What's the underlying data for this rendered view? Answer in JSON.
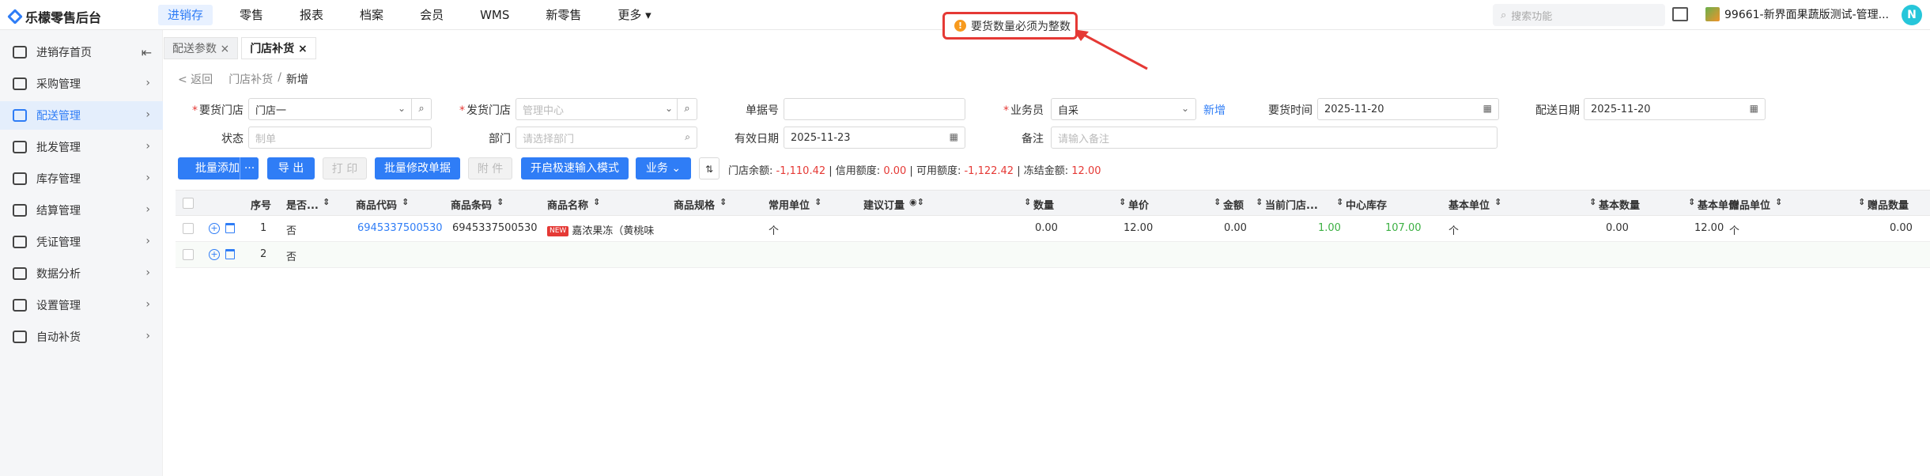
{
  "app": {
    "title": "乐檬零售后台"
  },
  "top_nav": [
    {
      "label": "进销存",
      "active": true
    },
    {
      "label": "零售"
    },
    {
      "label": "报表"
    },
    {
      "label": "档案"
    },
    {
      "label": "会员"
    },
    {
      "label": "WMS"
    },
    {
      "label": "新零售"
    },
    {
      "label": "更多 ▾"
    }
  ],
  "search": {
    "placeholder": "搜索功能",
    "icon": "search-icon"
  },
  "store": {
    "name": "99661-新界面果蔬版测试-管理..."
  },
  "user": {
    "initial": "N"
  },
  "toast": {
    "message": "要货数量必须为整数",
    "icon": "warning-icon",
    "color": "#f79a1e"
  },
  "sidebar": [
    {
      "label": "进销存首页",
      "icon": "home-icon"
    },
    {
      "label": "采购管理",
      "icon": "cart-icon"
    },
    {
      "label": "配送管理",
      "icon": "delivery-icon",
      "active": true
    },
    {
      "label": "批发管理",
      "icon": "wholesale-icon"
    },
    {
      "label": "库存管理",
      "icon": "inventory-icon"
    },
    {
      "label": "结算管理",
      "icon": "settlement-icon"
    },
    {
      "label": "凭证管理",
      "icon": "voucher-icon"
    },
    {
      "label": "数据分析",
      "icon": "analytics-icon"
    },
    {
      "label": "设置管理",
      "icon": "settings-icon"
    },
    {
      "label": "自动补货",
      "icon": "auto-replenish-icon"
    }
  ],
  "tabs": [
    {
      "label": "配送参数 ×"
    },
    {
      "label": "门店补货 ×",
      "active": true
    }
  ],
  "breadcrumb": {
    "back": "< 返回",
    "parent": "门店补货",
    "sep": "/",
    "current": "新增"
  },
  "form": {
    "request_store": {
      "label": "要货门店",
      "value": "门店一"
    },
    "ship_store": {
      "label": "发货门店",
      "placeholder": "管理中心"
    },
    "doc_no": {
      "label": "单据号",
      "value": ""
    },
    "salesman": {
      "label": "业务员",
      "value": "自采",
      "add_link": "新增"
    },
    "request_time": {
      "label": "要货时间",
      "value": "2025-11-20"
    },
    "delivery_date": {
      "label": "配送日期",
      "value": "2025-11-20"
    },
    "status": {
      "label": "状态",
      "placeholder": "制单"
    },
    "department": {
      "label": "部门",
      "placeholder": "请选择部门"
    },
    "valid_date": {
      "label": "有效日期",
      "value": "2025-11-23"
    },
    "remark": {
      "label": "备注",
      "placeholder": "请输入备注"
    }
  },
  "toolbar": {
    "batch_add": "批量添加",
    "more": "···",
    "export": "导 出",
    "print": "打 印",
    "batch_edit": "批量修改单据",
    "attach": "附 件",
    "fast_input": "开启极速输入模式",
    "business": "业务 ⌄",
    "balance_label": "门店余额:",
    "balance_value": "-1,110.42",
    "credit_label": "信用额度:",
    "credit_value": "0.00",
    "available_label": "可用额度:",
    "available_value": "-1,122.42",
    "frozen_label": "冻结金额:",
    "frozen_value": "12.00",
    "sep": "|"
  },
  "table": {
    "columns": [
      "序号",
      "是否...",
      "商品代码",
      "商品条码",
      "商品名称",
      "商品规格",
      "常用单位",
      "建议订量",
      "数量",
      "单价",
      "金额",
      "当前门店...",
      "中心库存",
      "基本单位",
      "基本数量",
      "基本单价",
      "赠品单位",
      "赠品数量"
    ],
    "rows": [
      {
        "no": "1",
        "flag": "否",
        "code": "6945337500530",
        "barcode": "6945337500530",
        "new_tag": "NEW",
        "name": "嘉浓果冻（黄桃味",
        "spec": "",
        "unit": "个",
        "suggest": "",
        "qty": "0.00",
        "price": "12.00",
        "amount": "0.00",
        "store_stock": "1.00",
        "center_stock": "107.00",
        "base_unit": "个",
        "base_qty": "0.00",
        "base_price": "12.00",
        "gift_unit": "个",
        "gift_qty": "0.00"
      },
      {
        "no": "2",
        "flag": "否"
      }
    ]
  }
}
